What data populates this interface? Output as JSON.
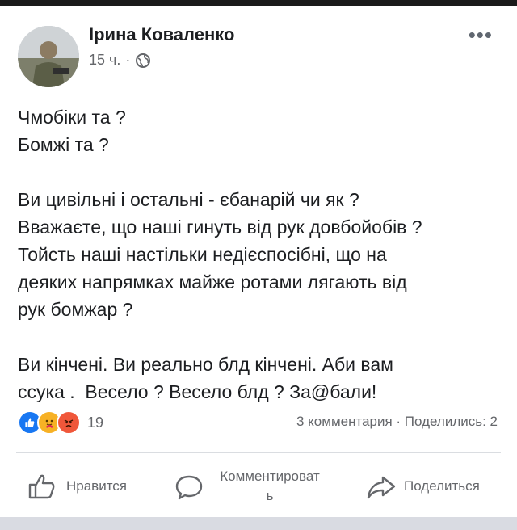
{
  "author": {
    "name": "Ірина Коваленко",
    "time": "15 ч.",
    "separator": "·"
  },
  "post": {
    "lines_group1": [
      "Чмобіки та ?",
      "Бомжі та ?"
    ],
    "lines_group2": [
      "Ви цивільні і остальні - єбанарій чи як ?",
      "Вважаєте, що наші гинуть від рук довбойобів ?",
      "Тойсть наші настільки недієспосібні, що на",
      "деяких напрямках майже ротами лягають від",
      "рук бомжар ?"
    ],
    "lines_group3": [
      "Ви кінчені. Ви реально блд кінчені. Аби вам",
      "ссука .  Весело ? Весело блд ? За@бали!"
    ]
  },
  "reactions": {
    "count": "19",
    "types": [
      "like-icon",
      "care-icon",
      "angry-icon"
    ]
  },
  "stats": {
    "text": "3 комментария · Поделились: 2"
  },
  "actions": {
    "like": "Нравится",
    "comment": "Комментироват\nь",
    "share": "Поделиться"
  },
  "colors": {
    "like": "#1877f2",
    "care": "#f7b125",
    "angry": "#f0573a",
    "muted": "#65676b"
  }
}
